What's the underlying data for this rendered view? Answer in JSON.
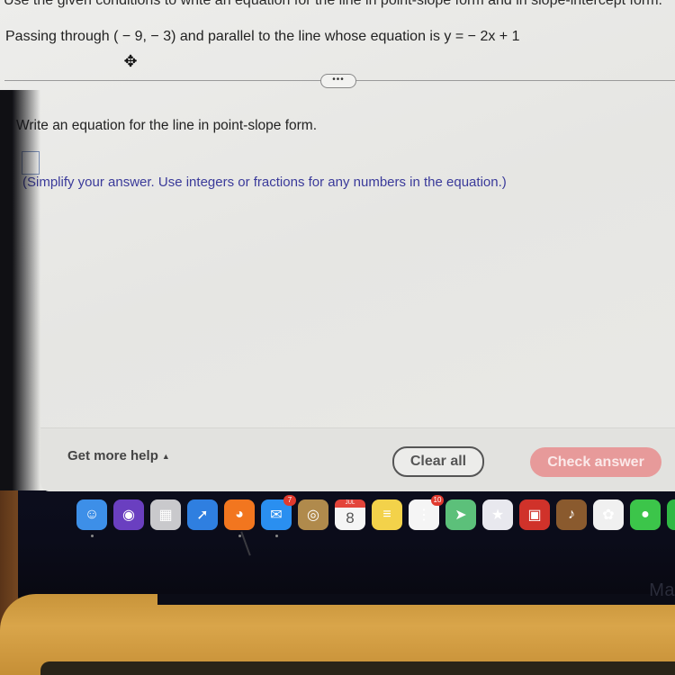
{
  "problem": {
    "instructions": "Use the given conditions to write an equation for the line in point-slope form and in slope-intercept form.",
    "statement": "Passing through ( − 9, − 3) and parallel to the line whose equation is y =  − 2x + 1",
    "move_glyph": "✥",
    "expand_label": "•••"
  },
  "question": {
    "prompt": "Write an equation for the line in point-slope form.",
    "answer_value": "",
    "hint": "(Simplify your answer. Use integers or fractions for any numbers in the equation.)"
  },
  "footer": {
    "help_label": "Get more help",
    "help_caret": "▲",
    "clear_label": "Clear all",
    "check_label": "Check answer"
  },
  "dock": {
    "items": [
      {
        "name": "finder",
        "glyph": "☺",
        "color": "#3d8fe8",
        "running": true
      },
      {
        "name": "siri",
        "glyph": "◉",
        "color": "#6a3fc0",
        "running": false
      },
      {
        "name": "launchpad",
        "glyph": "▦",
        "color": "#c9c9cc",
        "running": false
      },
      {
        "name": "safari",
        "glyph": "➚",
        "color": "#2f7fe0",
        "running": false
      },
      {
        "name": "firefox",
        "glyph": "◕",
        "color": "#f2761f",
        "running": true
      },
      {
        "name": "mail",
        "glyph": "✉",
        "color": "#2a8ff0",
        "running": true,
        "badge": "7"
      },
      {
        "name": "contacts",
        "glyph": "◎",
        "color": "#b08a4c",
        "running": false
      },
      {
        "name": "calendar",
        "glyph": "",
        "color": "#f5f5f5",
        "running": false,
        "month": "JUL",
        "day": "8"
      },
      {
        "name": "notes",
        "glyph": "≡",
        "color": "#f3d24a",
        "running": false
      },
      {
        "name": "reminders",
        "glyph": "⋮",
        "color": "#f5f5f5",
        "running": false,
        "badge": "10"
      },
      {
        "name": "maps",
        "glyph": "➤",
        "color": "#5cc07a",
        "running": false
      },
      {
        "name": "imovie",
        "glyph": "★",
        "color": "#e8e8ee",
        "running": false
      },
      {
        "name": "photo-booth",
        "glyph": "▣",
        "color": "#d0322a",
        "running": false
      },
      {
        "name": "garageband",
        "glyph": "♪",
        "color": "#8a5a2e",
        "running": false
      },
      {
        "name": "photos",
        "glyph": "✿",
        "color": "#f0f0f0",
        "running": false
      },
      {
        "name": "messages",
        "glyph": "●",
        "color": "#3cc54a",
        "running": false
      },
      {
        "name": "facetime",
        "glyph": "",
        "color": "#2fb844",
        "running": false
      }
    ]
  },
  "device": {
    "brand_text": "Ma"
  }
}
